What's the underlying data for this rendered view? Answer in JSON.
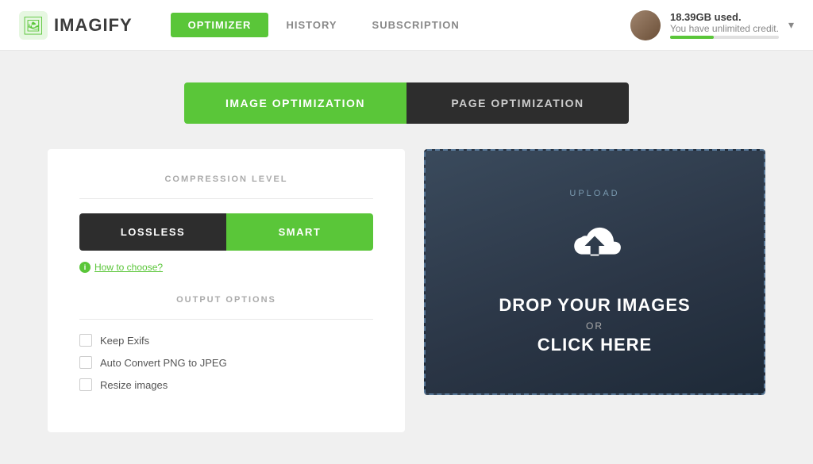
{
  "header": {
    "logo_text": "IMAGIFY",
    "nav": {
      "items": [
        {
          "id": "optimizer",
          "label": "OPTIMIZER",
          "active": true
        },
        {
          "id": "history",
          "label": "HISTORY",
          "active": false
        },
        {
          "id": "subscription",
          "label": "SUBSCRIPTION",
          "active": false
        }
      ]
    },
    "user": {
      "usage": "18.39GB used.",
      "credit": "You have unlimited credit."
    }
  },
  "main": {
    "tab_switcher": {
      "image_optimization": "IMAGE OPTIMIZATION",
      "page_optimization": "PAGE OPTIMIZATION"
    },
    "left_panel": {
      "compression_label": "COMPRESSION LEVEL",
      "lossless_btn": "LOSSLESS",
      "smart_btn": "SMART",
      "how_to_choose": "How to choose?",
      "output_label": "OUTPUT OPTIONS",
      "checkboxes": [
        {
          "id": "keep-exifs",
          "label": "Keep Exifs"
        },
        {
          "id": "auto-convert",
          "label": "Auto Convert PNG to JPEG"
        },
        {
          "id": "resize-images",
          "label": "Resize images"
        }
      ]
    },
    "upload_panel": {
      "upload_label": "UPLOAD",
      "drop_text": "DROP YOUR IMAGES",
      "or_text": "OR",
      "click_text": "CLICK HERE"
    }
  }
}
